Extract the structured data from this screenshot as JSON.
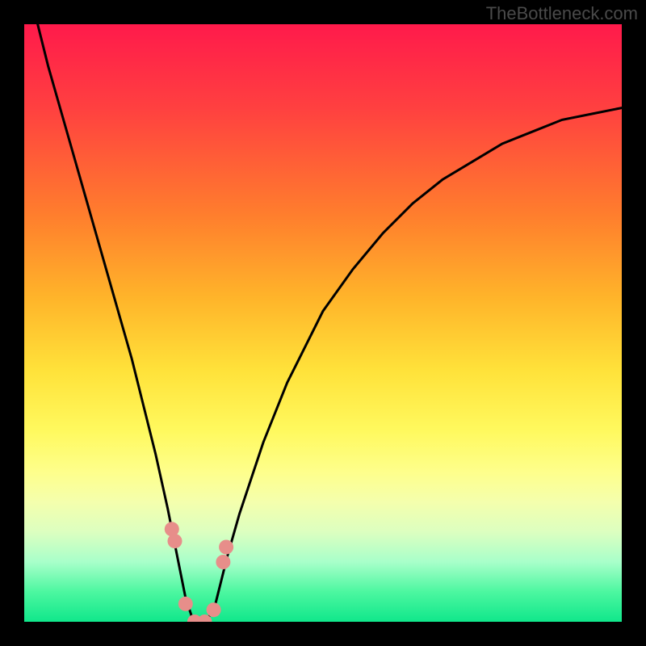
{
  "watermark": "TheBottleneck.com",
  "colors": {
    "frame": "#000000",
    "curve": "#000000",
    "markers": "#e78e8a"
  },
  "chart_data": {
    "type": "line",
    "title": "",
    "xlabel": "",
    "ylabel": "",
    "xlim": [
      0,
      100
    ],
    "ylim": [
      0,
      100
    ],
    "grid": false,
    "legend": false,
    "series": [
      {
        "name": "bottleneck-curve",
        "x": [
          0,
          2,
          4,
          6,
          8,
          10,
          12,
          14,
          16,
          18,
          20,
          22,
          24,
          26,
          27,
          28,
          29,
          30,
          31,
          32,
          33,
          34,
          36,
          38,
          40,
          42,
          44,
          46,
          48,
          50,
          55,
          60,
          65,
          70,
          75,
          80,
          85,
          90,
          95,
          100
        ],
        "values": [
          109,
          101,
          93,
          86,
          79,
          72,
          65,
          58,
          51,
          44,
          36,
          28,
          19,
          9,
          4,
          1,
          0,
          0,
          1,
          3,
          7,
          11,
          18,
          24,
          30,
          35,
          40,
          44,
          48,
          52,
          59,
          65,
          70,
          74,
          77,
          80,
          82,
          84,
          85,
          86
        ],
        "note": "values are the V-shaped bottleneck percentage; minimum plateau at x≈29–30"
      }
    ],
    "markers": {
      "name": "highlighted-points",
      "x": [
        24.7,
        25.2,
        27.0,
        28.5,
        30.2,
        31.7,
        33.3,
        33.8
      ],
      "values": [
        15.5,
        13.5,
        3.0,
        0.0,
        0.0,
        2.0,
        10.0,
        12.5
      ],
      "note": "pink dots near the curve minimum"
    }
  }
}
